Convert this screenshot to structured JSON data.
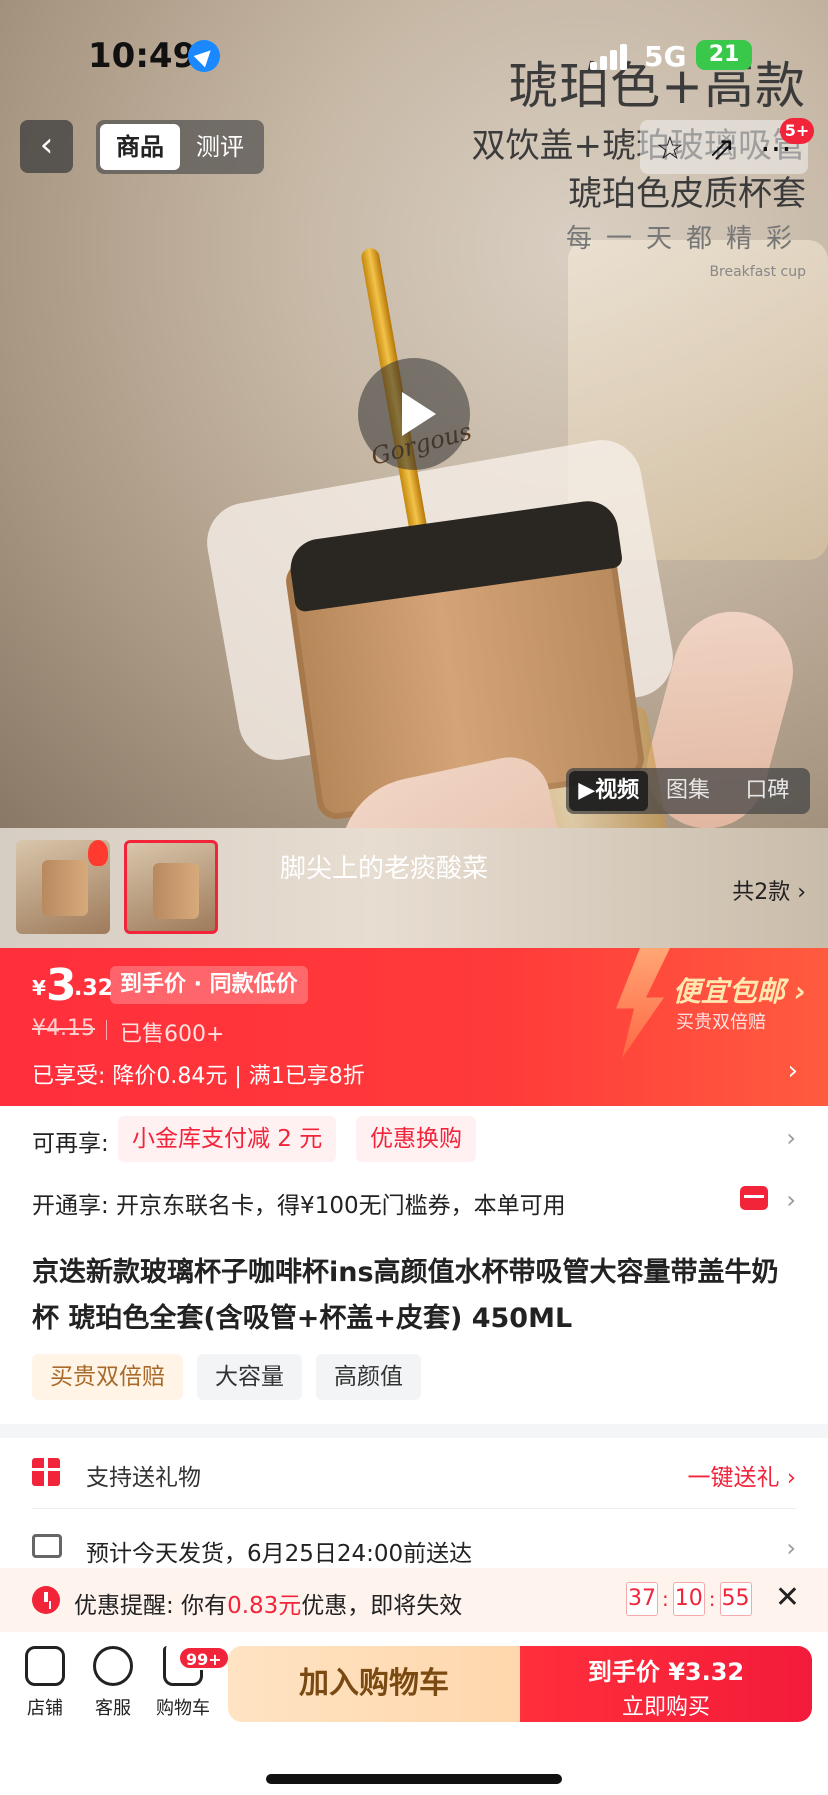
{
  "status_bar": {
    "time": "10:49",
    "network": "5G",
    "battery": "21"
  },
  "nav": {
    "back_glyph": "‹",
    "tabs": [
      {
        "label": "商品",
        "active": true
      },
      {
        "label": "测评",
        "active": false
      }
    ],
    "message_badge": "5+",
    "icons": [
      "star-icon",
      "share-icon",
      "more-icon"
    ]
  },
  "hero": {
    "lines": [
      "琥珀色+高款",
      "双饮盖+琥珀玻璃吸管",
      "琥珀色皮质杯套",
      "每一天都精彩",
      "Breakfast cup"
    ],
    "brand_on_sleeve": "Gorgous",
    "media_tabs": [
      {
        "label": "▶视频",
        "active": true
      },
      {
        "label": "图集",
        "active": false
      },
      {
        "label": "口碑",
        "active": false
      }
    ]
  },
  "thumbs": {
    "overlay_name": "脚尖上的老痰酸菜",
    "variant_count": "共2款 ›"
  },
  "price": {
    "currency": "¥",
    "major": "3",
    "minor": ".32",
    "tag": "到手价 · 同款低价",
    "original": "¥4.15",
    "sold": "已售600+",
    "enjoyed": "已享受:  降价0.84元  |  满1已享8折",
    "promo_title": "便宜包邮 ›",
    "promo_sub": "买贵双倍赔",
    "accent": "#f2243a"
  },
  "extra": {
    "label": "可再享:",
    "chips": [
      "小金库支付减 2 元",
      "优惠换购"
    ]
  },
  "card": {
    "text": "开通享: 开京东联名卡，得¥100无门槛券，本单可用"
  },
  "product": {
    "title": "京迭新款玻璃杯子咖啡杯ins高颜值水杯带吸管大容量带盖牛奶杯 琥珀色全套(含吸管+杯盖+皮套) 450ML",
    "tags": [
      {
        "label": "买贵双倍赔",
        "gold": true
      },
      {
        "label": "大容量",
        "gold": false
      },
      {
        "label": "高颜值",
        "gold": false
      }
    ]
  },
  "gift": {
    "label": "支持送礼物",
    "action": "一键送礼 ›"
  },
  "ship": {
    "label": "预计今天发货，6月25日24:00前送达"
  },
  "remind": {
    "prefix": "优惠提醒: 你有",
    "amount": "0.83元",
    "suffix": "优惠，即将失效",
    "timer": [
      "37",
      "10",
      "55"
    ],
    "close": "✕"
  },
  "bottom": {
    "store": "店铺",
    "service": "客服",
    "cart": "购物车",
    "cart_badge": "99+",
    "add_to_cart": "加入购物车",
    "buy_line1": "到手价 ¥3.32",
    "buy_line2": "立即购买"
  },
  "chevron": "›"
}
